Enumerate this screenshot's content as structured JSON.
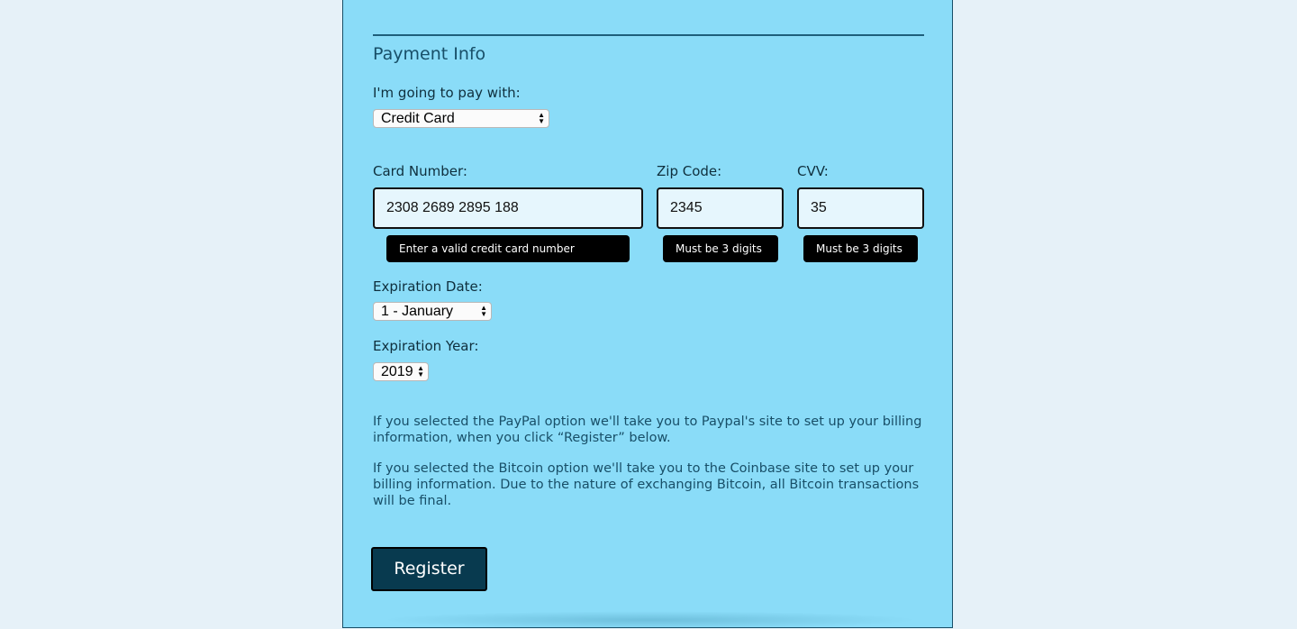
{
  "section": {
    "legend": "Payment Info"
  },
  "payment": {
    "label": "I'm going to pay with:",
    "selected": "Credit Card"
  },
  "card": {
    "number_label": "Card Number:",
    "number_value": "2308 2689 2895 188",
    "number_error": "Enter a valid credit card number",
    "zip_label": "Zip Code:",
    "zip_value": "2345",
    "zip_error": "Must be 3 digits",
    "cvv_label": "CVV:",
    "cvv_value": "35",
    "cvv_error": "Must be 3 digits"
  },
  "expiration": {
    "date_label": "Expiration Date:",
    "date_selected": "1 - January",
    "year_label": "Expiration Year:",
    "year_selected": "2019"
  },
  "info": {
    "paypal": "If you selected the PayPal option we'll take you to Paypal's site to set up your billing information, when you click “Register” below.",
    "bitcoin": "If you selected the Bitcoin option we'll take you to the Coinbase site to set up your billing information. Due to the nature of exchanging Bitcoin, all Bitcoin transactions will be final."
  },
  "actions": {
    "register_label": "Register"
  },
  "icons": {
    "select_arrows": "up-down-arrows-icon"
  },
  "colors": {
    "panel_bg": "#8adcf8",
    "page_bg": "#e6f1f8",
    "button_bg": "#083a4f",
    "heading": "#184f68",
    "tooltip_bg": "#000000"
  }
}
